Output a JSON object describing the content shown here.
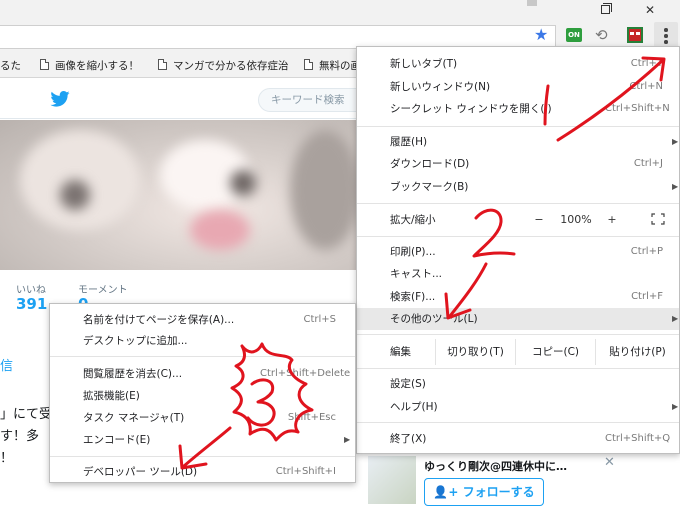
{
  "window": {
    "min_icon": "minimize-icon",
    "max_icon": "restore-icon",
    "close_symbol": "✕"
  },
  "toolbar": {
    "star_icon": "star-icon",
    "ext_on_label": "ON",
    "menu_icon": "vertical-dots-icon"
  },
  "bookmarks": [
    {
      "label": "るた"
    },
    {
      "label": "画像を縮小する！"
    },
    {
      "label": "マンガで分かる依存症治"
    },
    {
      "label": "無料の画"
    }
  ],
  "page": {
    "search_placeholder": "キーワード検索",
    "stats": [
      {
        "label": "いいね",
        "value": "391"
      },
      {
        "label": "モーメント",
        "value": "0"
      }
    ],
    "left_fragments": [
      "信",
      "」にて受",
      "す！多",
      "！"
    ],
    "follow_card": {
      "name": "ゆっくり剛次@四連休中に…",
      "follow_label": "フォローする",
      "close": "✕"
    }
  },
  "main_menu": {
    "items": [
      {
        "label": "新しいタブ(T)",
        "shortcut": "Ctrl+T"
      },
      {
        "label": "新しいウィンドウ(N)",
        "shortcut": "Ctrl+N"
      },
      {
        "label": "シークレット ウィンドウを開く(I)",
        "shortcut": "Ctrl+Shift+N"
      },
      {
        "label": "履歴(H)",
        "shortcut": "",
        "submenu": "▶"
      },
      {
        "label": "ダウンロード(D)",
        "shortcut": "Ctrl+J"
      },
      {
        "label": "ブックマーク(B)",
        "shortcut": "",
        "submenu": "▶"
      },
      {
        "label": "印刷(P)...",
        "shortcut": "Ctrl+P"
      },
      {
        "label": "キャスト...",
        "shortcut": ""
      },
      {
        "label": "検索(F)...",
        "shortcut": "Ctrl+F"
      },
      {
        "label": "その他のツール(L)",
        "shortcut": "",
        "submenu": "▶"
      },
      {
        "label": "設定(S)",
        "shortcut": ""
      },
      {
        "label": "ヘルプ(H)",
        "shortcut": "",
        "submenu": "▶"
      },
      {
        "label": "終了(X)",
        "shortcut": "Ctrl+Shift+Q"
      }
    ],
    "zoom": {
      "label": "拡大/縮小",
      "minus": "−",
      "value": "100%",
      "plus": "+",
      "fullscreen_icon": "fullscreen-icon"
    },
    "edit": {
      "label": "編集",
      "cut": "切り取り(T)",
      "copy": "コピー(C)",
      "paste": "貼り付け(P)"
    }
  },
  "sub_menu": {
    "items": [
      {
        "label": "名前を付けてページを保存(A)...",
        "shortcut": "Ctrl+S"
      },
      {
        "label": "デスクトップに追加...",
        "shortcut": ""
      },
      {
        "label": "閲覧履歴を消去(C)...",
        "shortcut": "Ctrl+Shift+Delete"
      },
      {
        "label": "拡張機能(E)",
        "shortcut": ""
      },
      {
        "label": "タスク マネージャ(T)",
        "shortcut": "Shift+Esc"
      },
      {
        "label": "エンコード(E)",
        "shortcut": "",
        "submenu": "▶"
      },
      {
        "label": "デベロッパー ツール(D)",
        "shortcut": "Ctrl+Shift+I"
      }
    ]
  },
  "annotations": {
    "step1": "1",
    "step2": "2",
    "step3": "3",
    "ink_color": "#e0141e"
  }
}
